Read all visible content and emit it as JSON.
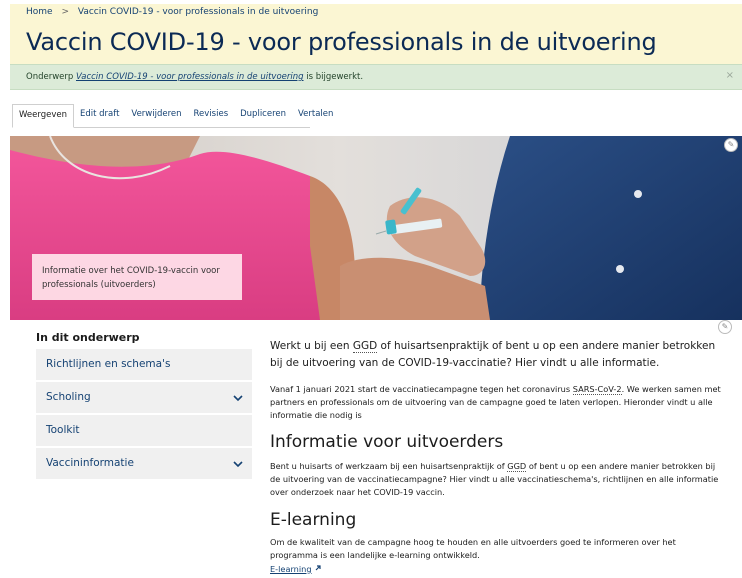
{
  "breadcrumb": {
    "home": "Home",
    "separator": ">",
    "current": "Vaccin COVID-19 - voor professionals in de uitvoering"
  },
  "page": {
    "title": "Vaccin COVID-19 - voor professionals in de uitvoering"
  },
  "status": {
    "prefix": "Onderwerp",
    "link": "Vaccin COVID-19 - voor professionals in de uitvoering",
    "suffix": "is bijgewerkt.",
    "close": "×"
  },
  "tabs": [
    {
      "label": "Weergeven",
      "active": true
    },
    {
      "label": "Edit draft"
    },
    {
      "label": "Verwijderen"
    },
    {
      "label": "Revisies"
    },
    {
      "label": "Dupliceren"
    },
    {
      "label": "Vertalen"
    }
  ],
  "hero": {
    "caption": "Informatie over het COVID-19-vaccin voor professionals (uitvoerders)",
    "edit_icon": "pencil-icon"
  },
  "sidenav": {
    "title": "In dit onderwerp",
    "items": [
      {
        "label": "Richtlijnen en schema's",
        "has_children": false
      },
      {
        "label": "Scholing",
        "has_children": true
      },
      {
        "label": "Toolkit",
        "has_children": false
      },
      {
        "label": "Vaccininformatie",
        "has_children": true
      }
    ]
  },
  "content": {
    "lead_a": "Werkt u bij een ",
    "lead_abbr": "GGD",
    "lead_b": " of huisartsenpraktijk of bent u op een andere manier betrokken bij de uitvoering van de  COVID-19-vaccinatie? Hier vindt u alle informatie.",
    "para1_a": "Vanaf 1 januari 2021 start de vaccinatiecampagne tegen het coronavirus ",
    "para1_abbr": "SARS-CoV-2",
    "para1_b": ". We werken samen met partners en professionals om de uitvoering van de campagne goed te laten verlopen. Hieronder vindt u alle informatie die nodig is",
    "h2_uitvoerders": "Informatie voor uitvoerders",
    "para2_a": "Bent u huisarts of werkzaam bij een huisartsenpraktijk of ",
    "para2_abbr": "GGD",
    "para2_b": " of bent u op een andere manier betrokken bij de uitvoering van de vaccinatiecampagne? Hier vindt u alle vaccinatieschema's, richtlijnen en alle informatie over onderzoek naar het COVID-19 vaccin.",
    "h2_elearning": "E-learning",
    "para3": "Om de kwaliteit van de campagne hoog te houden en alle uitvoerders goed te informeren over het programma is een landelijke e-learning ontwikkeld.",
    "elearning_link": "E-learning",
    "external_icon": "external-link-icon"
  },
  "colors": {
    "brand": "#154273",
    "header_bg": "#fbf6d3",
    "status_bg": "#dcebd8",
    "nav_bg": "#f0f0f0"
  }
}
